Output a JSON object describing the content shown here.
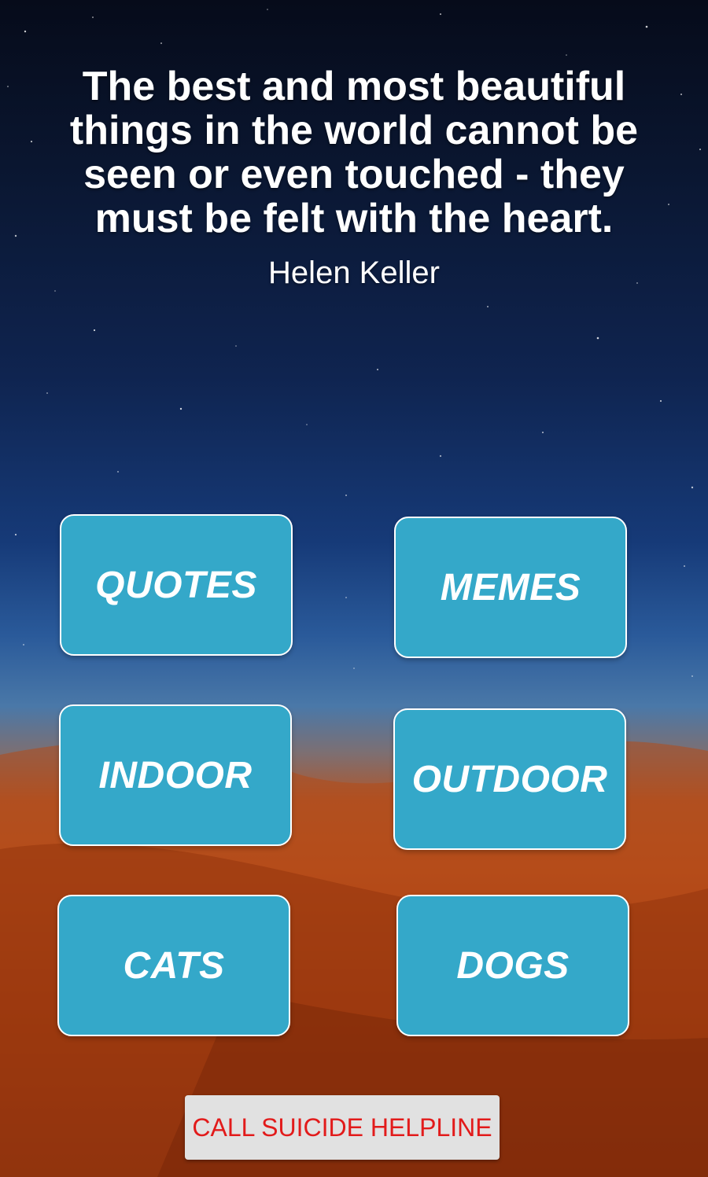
{
  "quote": {
    "text": "The best and most beautiful things in the world cannot be seen or even touched - they must be felt with the heart.",
    "author": "Helen Keller"
  },
  "categories": [
    {
      "label": "QUOTES"
    },
    {
      "label": "MEMES"
    },
    {
      "label": "INDOOR"
    },
    {
      "label": "OUTDOOR"
    },
    {
      "label": "CATS"
    },
    {
      "label": "DOGS"
    }
  ],
  "helpline": {
    "label": "CALL SUICIDE HELPLINE"
  },
  "colors": {
    "button_bg": "#34a8c9",
    "button_text": "#ffffff",
    "helpline_bg": "#e1e1e1",
    "helpline_text": "#e21b1b"
  }
}
